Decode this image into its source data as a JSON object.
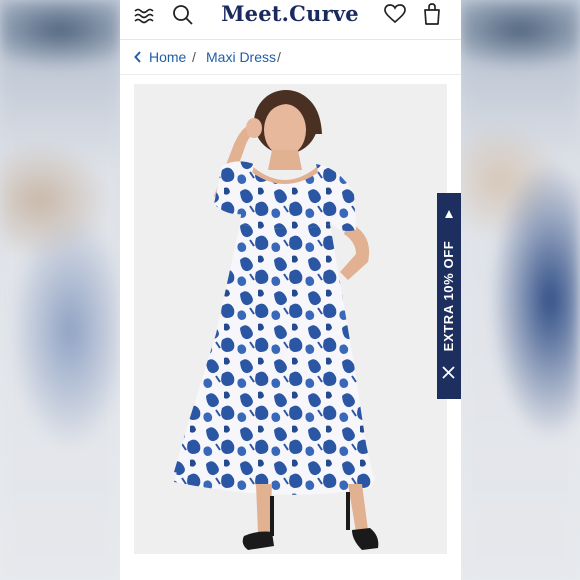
{
  "header": {
    "logo": "Meet.Curve",
    "icons": [
      "menu-icon",
      "search-icon",
      "heart-icon",
      "bag-icon"
    ]
  },
  "breadcrumb": {
    "items": [
      {
        "label": "Home"
      },
      {
        "label": "Maxi Dress"
      }
    ],
    "separator": "/"
  },
  "promo": {
    "label": "EXTRA 10% OFF",
    "close_icon": "close-icon",
    "arrow_icon": "triangle-up-icon"
  },
  "colors": {
    "brand_navy": "#1b2a5e",
    "link_blue": "#1f5fa6",
    "dress_blue": "#2b56a3",
    "promo_bg": "#1c2f5f"
  }
}
